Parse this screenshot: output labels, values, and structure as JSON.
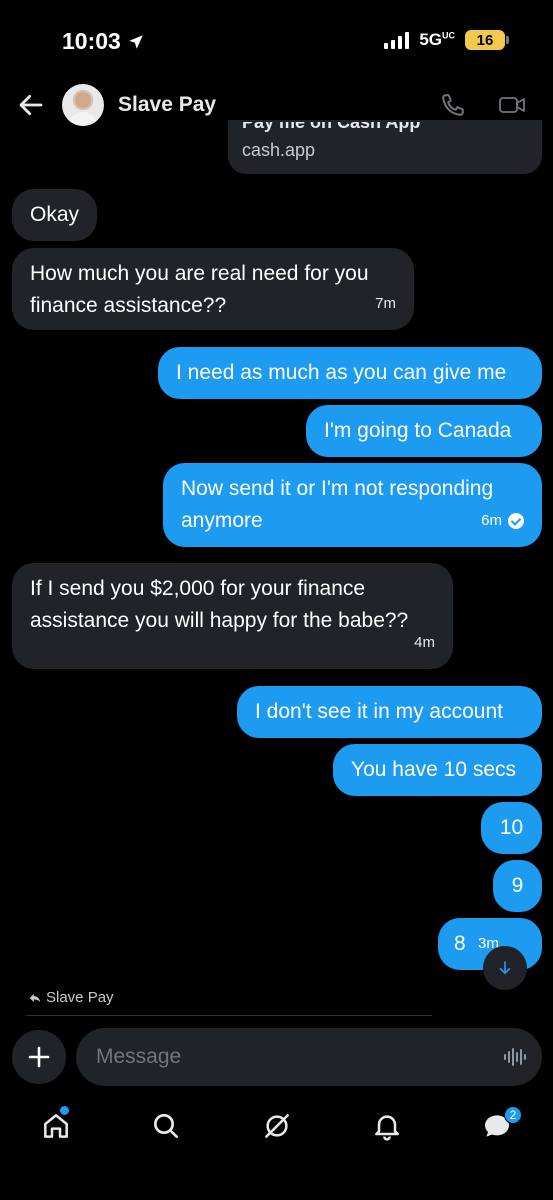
{
  "status": {
    "time": "10:03",
    "network": "5G",
    "battery": "16"
  },
  "header": {
    "name": "Slave Pay"
  },
  "link_card": {
    "title": "Pay me on Cash App",
    "domain": "cash.app"
  },
  "messages": [
    {
      "side": "in",
      "text": "Okay",
      "time": ""
    },
    {
      "side": "in",
      "text": "How much you are real need for you finance assistance??",
      "time": "7m"
    },
    {
      "side": "out",
      "text": "I need as much as you can give me",
      "time": ""
    },
    {
      "side": "out",
      "text": "I'm going to Canada",
      "time": ""
    },
    {
      "side": "out",
      "text": "Now send it or I'm not responding anymore",
      "time": "6m"
    },
    {
      "side": "in",
      "text": "If I send you $2,000 for your finance assistance you will happy for the babe??",
      "time": "4m"
    },
    {
      "side": "out",
      "text": "I don't see it in my account",
      "time": ""
    },
    {
      "side": "out",
      "text": "You have 10 secs",
      "time": ""
    },
    {
      "side": "out",
      "text": "10",
      "time": ""
    },
    {
      "side": "out",
      "text": "9",
      "time": ""
    },
    {
      "side": "out",
      "text": "8",
      "time": "3m"
    }
  ],
  "reply_label": "Slave Pay",
  "composer": {
    "placeholder": "Message"
  },
  "nav": {
    "messages_badge": "2"
  }
}
